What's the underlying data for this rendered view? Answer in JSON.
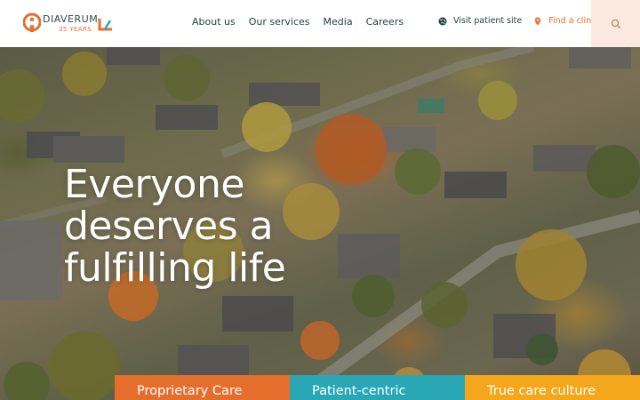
{
  "header": {
    "logo": {
      "brand": "DIAVERUM",
      "sub": "35 YEARS"
    },
    "nav": [
      {
        "label": "About us"
      },
      {
        "label": "Our services"
      },
      {
        "label": "Media"
      },
      {
        "label": "Careers"
      }
    ],
    "visit_patient_site": "Visit patient site",
    "find_clinic": "Find a clinic",
    "search_icon": "search-icon"
  },
  "hero": {
    "headline_lines": [
      "Everyone",
      "deserves a",
      "fulfilling life"
    ],
    "background": "aerial-neighbourhood-photo"
  },
  "tabs": [
    {
      "label": "Proprietary Care",
      "color": "#e56e2d"
    },
    {
      "label": "Patient-centric",
      "color": "#2aa7b5"
    },
    {
      "label": "True care culture",
      "color": "#f5a71c"
    }
  ],
  "colors": {
    "brand_orange": "#e56e2d",
    "brand_dark": "#1f3f3b",
    "search_bg": "#fbe9df"
  }
}
